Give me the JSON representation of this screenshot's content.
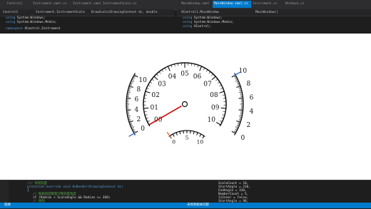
{
  "editor": {
    "tabs": [
      {
        "label": "Control1",
        "active": false
      },
      {
        "label": "Instrument.xaml.cs",
        "active": false
      },
      {
        "label": "Instrument.xaml",
        "active": false
      },
      {
        "label": "InstrumentScale.cs",
        "active": false
      },
      {
        "label": "MainWindow.xaml",
        "active": false
      },
      {
        "label": "MainWindow.xaml.cs",
        "active": true
      },
      {
        "label": "Instrument.cs",
        "active": false
      },
      {
        "label": "Window1.cs",
        "active": false
      }
    ],
    "navbar_left": [
      "Control1",
      "Instrument.InstrumentScale",
      "DrawScale(DrawingContext dc, double"
    ],
    "navbar_right": [
      "XControl1.MainWindow",
      "MainWindow()"
    ],
    "code_top_left": [
      {
        "kw": "using",
        "text": "System.Windows;"
      },
      {
        "kw": "using",
        "text": "System.Windows.Media;"
      },
      {
        "kw": "",
        "text": ""
      },
      {
        "kw": "namespace",
        "text": "XControl.Instrument"
      }
    ],
    "code_top_right": [
      {
        "kw": "using",
        "text": "System.Windows;"
      },
      {
        "kw": "using",
        "text": "System.Windows.Media;"
      },
      {
        "kw": "using",
        "text": "XControl;"
      }
    ],
    "code_bottom_left": [
      {
        "cls": "cm",
        "text": "/// 绘制刻度"
      },
      {
        "cls": "kw",
        "text": "protected override void OnRender(DrawingContext dc)"
      },
      {
        "cls": "id",
        "text": "{"
      },
      {
        "cls": "cm",
        "text": "// 根据刻度数量计算刻度角度"
      },
      {
        "cls": "id",
        "text": "if (Radian > ScaleAngle && Radian >= 360)"
      },
      {
        "cls": "cm",
        "text": "// 绘制"
      }
    ],
    "code_bottom_right": [
      "ScaleCount = 10,",
      "StartAngle = 210,",
      "EndAngle = 330,",
      "NumberCount = 5,",
      "IsInner = false,",
      "StartAngle = 90,"
    ],
    "status": {
      "left": "就绪",
      "right": "未找到相关问题"
    }
  },
  "gauges": {
    "outer": {
      "left_labels": [
        "0",
        "2",
        "4",
        "6",
        "8",
        "10"
      ],
      "right_labels": [
        "0",
        "2",
        "4",
        "6",
        "8",
        "10"
      ],
      "left_value": 0,
      "right_value": 10
    },
    "main": {
      "labels": [
        "00",
        "01",
        "02",
        "03",
        "04",
        "05",
        "06",
        "07",
        "08",
        "09",
        "10"
      ],
      "value": 0
    },
    "small": {
      "labels": [
        "0",
        "5",
        "10"
      ],
      "value": 0
    }
  }
}
